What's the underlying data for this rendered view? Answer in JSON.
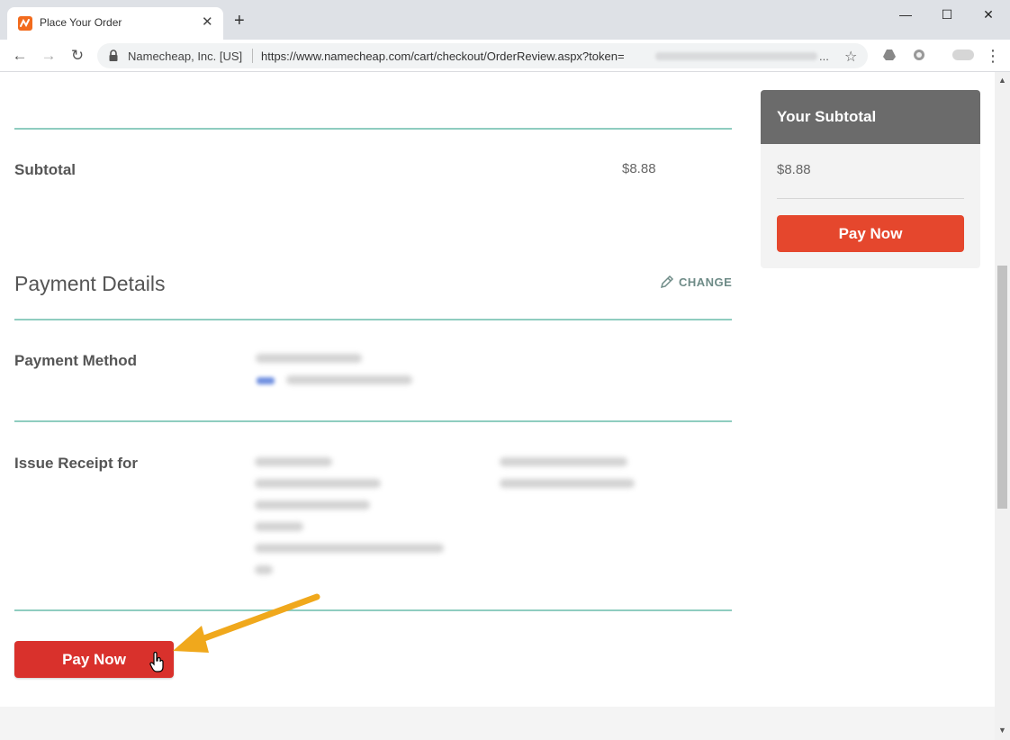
{
  "browser": {
    "tab_title": "Place Your Order",
    "tab_close": "✕",
    "new_tab": "+",
    "minimize": "—",
    "maximize": "☐",
    "close": "✕",
    "back": "←",
    "forward": "→",
    "reload": "↻",
    "site_identity": "Namecheap, Inc. [US]",
    "url": "https://www.namecheap.com/cart/checkout/OrderReview.aspx?token=",
    "url_ellipsis": "...",
    "bookmark": "☆",
    "menu": "⋮"
  },
  "order": {
    "subtotal_label": "Subtotal",
    "subtotal_value": "$8.88"
  },
  "payment": {
    "section_title": "Payment Details",
    "change_label": "CHANGE",
    "method_label": "Payment Method",
    "receipt_label": "Issue Receipt for",
    "pay_button": "Pay Now"
  },
  "sidebar": {
    "title": "Your Subtotal",
    "amount": "$8.88",
    "pay_button": "Pay Now"
  },
  "colors": {
    "accent_rule": "#8fcdc0",
    "pay_red": "#d9312c",
    "pay_orange": "#e5472d",
    "arrow": "#f0a81c"
  }
}
